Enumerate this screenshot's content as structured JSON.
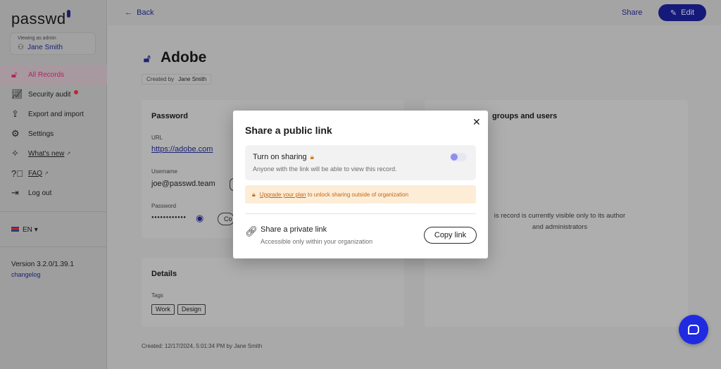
{
  "app": {
    "logo": "passwd"
  },
  "sidebar": {
    "viewing_caption": "Viewing as admin",
    "viewing_user": "Jane Smith",
    "items": [
      {
        "label": "All Records",
        "icon": "lock-icon",
        "active": true
      },
      {
        "label": "Security audit",
        "icon": "chart-icon",
        "badge": "red-dot"
      },
      {
        "label": "Export and import",
        "icon": "upload-icon"
      },
      {
        "label": "Settings",
        "icon": "gear-icon"
      },
      {
        "label": "What's new",
        "icon": "party-icon",
        "external": true
      },
      {
        "label": "FAQ",
        "icon": "question-icon",
        "external": true
      },
      {
        "label": "Log out",
        "icon": "logout-icon"
      }
    ],
    "language": "EN",
    "version": "Version 3.2.0/1.39.1",
    "changelog": "changelog"
  },
  "topbar": {
    "back_label": "Back",
    "share_label": "Share",
    "edit_label": "Edit"
  },
  "record": {
    "title": "Adobe",
    "created_by_label": "Created by",
    "created_by": "Jane Smith",
    "password_card": {
      "title": "Password",
      "url_label": "URL",
      "url": "https://adobe.com",
      "username_label": "Username",
      "username": "joe@passwd.team",
      "password_label": "Password",
      "password_masked": "●●●●●●●●●●●●",
      "copy_partial": "Co"
    },
    "details_card": {
      "title": "Details",
      "tags_label": "Tags",
      "tags": [
        "Work",
        "Design"
      ]
    },
    "groups_card": {
      "title_partial": "groups and users",
      "visibility_line1": "is record is currently visible only to its author",
      "visibility_line2": "and administrators"
    },
    "created_footer": "Created: 12/17/2024, 5:01:34 PM by Jane Smith"
  },
  "modal": {
    "title": "Share a public link",
    "sharing_label": "Turn on sharing",
    "sharing_desc": "Anyone with the link will be able to view this record.",
    "sharing_enabled": false,
    "upgrade_link": "Upgrade your plan",
    "upgrade_rest": " to unlock sharing outside of organization",
    "private_label": "Share a private link",
    "private_desc": "Accessible only within your organization",
    "copy_button": "Copy link"
  },
  "colors": {
    "accent": "#151a7a",
    "active_nav": "#b0275e",
    "warning_bg": "#fdedd6",
    "warning_text": "#c0661a",
    "chat": "#1f2be0"
  }
}
